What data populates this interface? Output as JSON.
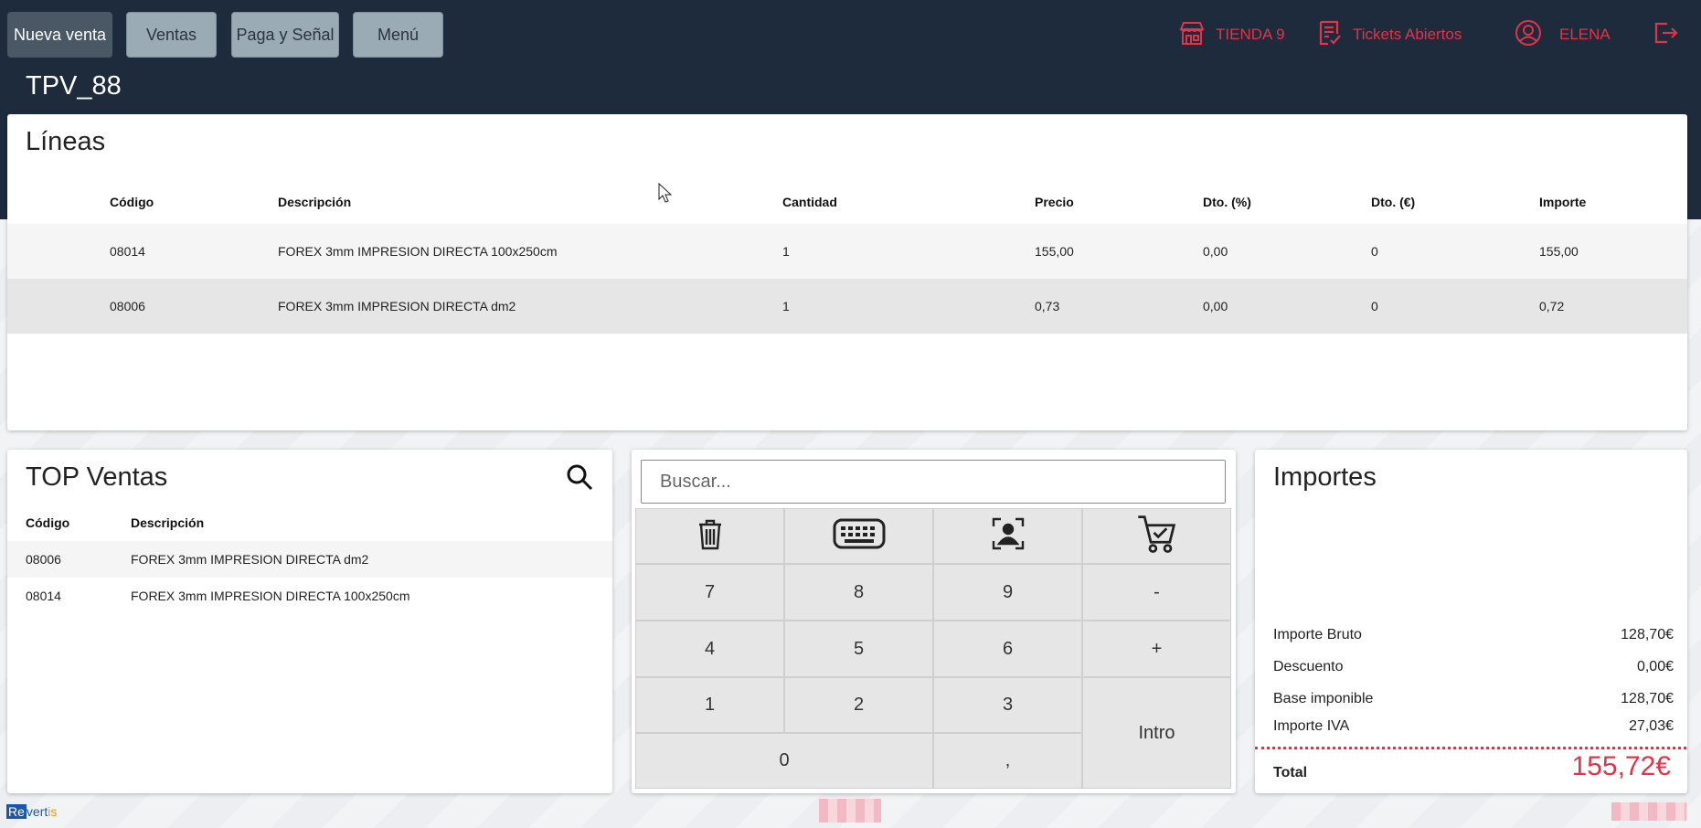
{
  "nav": {
    "buttons": [
      "Nueva venta",
      "Ventas",
      "Paga y Señal",
      "Menú"
    ],
    "store": "TIENDA 9",
    "tickets": "Tickets Abiertos",
    "user": "ELENA"
  },
  "terminal": "TPV_88",
  "lines": {
    "title": "Líneas",
    "headers": [
      "Código",
      "Descripción",
      "Cantidad",
      "Precio",
      "Dto. (%)",
      "Dto. (€)",
      "Importe"
    ],
    "rows": [
      [
        "08014",
        "FOREX 3mm IMPRESION DIRECTA 100x250cm",
        "1",
        "155,00",
        "0,00",
        "0",
        "155,00"
      ],
      [
        "08006",
        "FOREX 3mm IMPRESION DIRECTA dm2",
        "1",
        "0,73",
        "0,00",
        "0",
        "0,72"
      ]
    ]
  },
  "top": {
    "title": "TOP Ventas",
    "headers": [
      "Código",
      "Descripción"
    ],
    "rows": [
      [
        "08006",
        "FOREX 3mm IMPRESION DIRECTA dm2"
      ],
      [
        "08014",
        "FOREX 3mm IMPRESION DIRECTA 100x250cm"
      ]
    ]
  },
  "keypad": {
    "search_placeholder": "Buscar...",
    "keys": [
      "7",
      "8",
      "9",
      "-",
      "4",
      "5",
      "6",
      "+",
      "1",
      "2",
      "3",
      "Intro",
      "0",
      ","
    ]
  },
  "importes": {
    "title": "Importes",
    "rows": [
      [
        "Importe Bruto",
        "128,70€"
      ],
      [
        "Descuento",
        "0,00€"
      ],
      [
        "Base imponible",
        "128,70€"
      ],
      [
        "Importe IVA",
        "27,03€"
      ]
    ],
    "total_label": "Total",
    "total_value": "155,72€"
  },
  "brand": {
    "part1": "Re",
    "part2": "vert",
    "part3": "is"
  },
  "colors": {
    "header_bg": "#1e2b3c",
    "accent": "#e0344a",
    "nav_btn": "#9aabb6",
    "nav_active": "#4a5765"
  }
}
